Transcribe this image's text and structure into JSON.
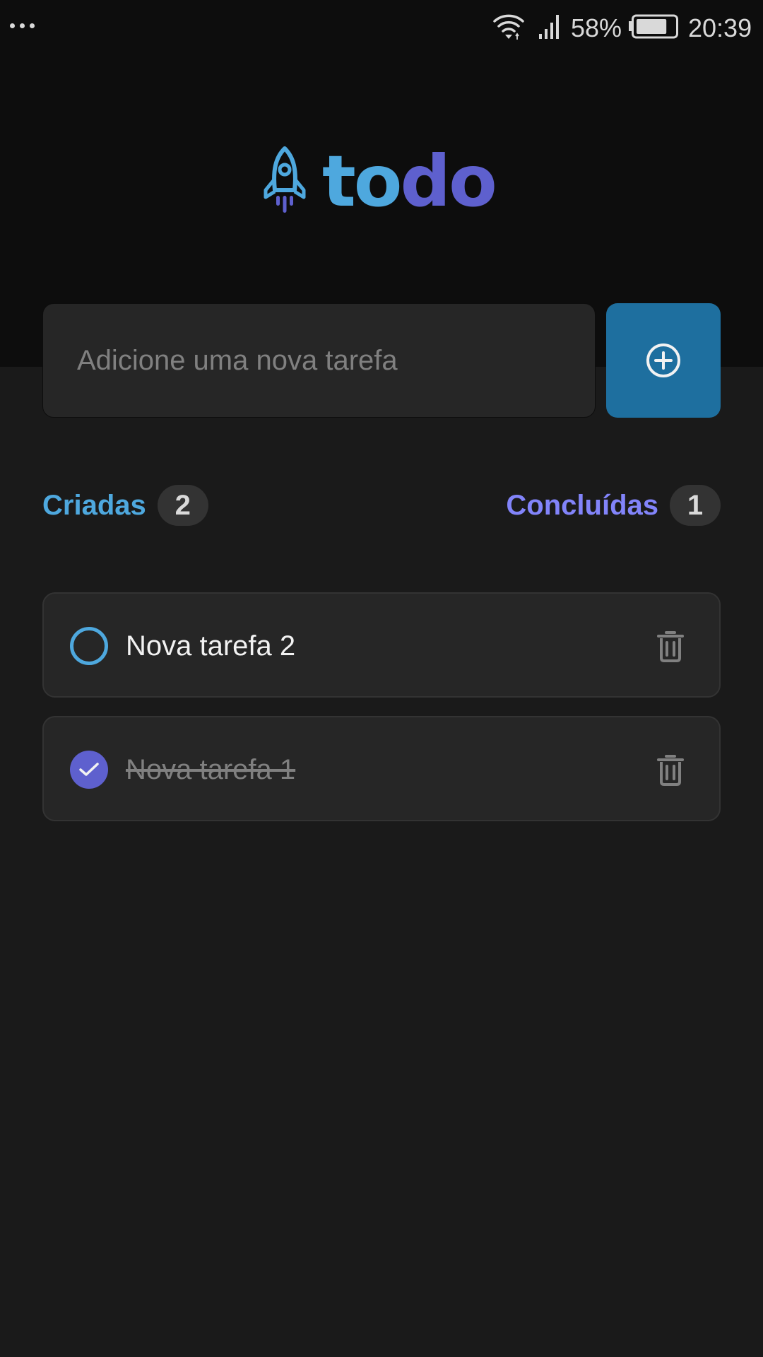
{
  "status_bar": {
    "menu_icon": "more-horizontal-icon",
    "wifi_icon": "wifi-icon",
    "signal_icon": "signal-icon",
    "battery_percent": "58%",
    "battery_icon": "battery-icon",
    "battery_level": 0.58,
    "time": "20:39"
  },
  "header": {
    "logo_icon": "rocket-icon",
    "logo_text_part1": "to",
    "logo_text_part2": "do",
    "colors": {
      "primary": "#4ea8de",
      "secondary": "#5e60ce"
    }
  },
  "new_task": {
    "placeholder": "Adicione uma nova tarefa",
    "value": "",
    "add_icon": "plus-circle-icon",
    "button_color": "#1e6f9f"
  },
  "counters": {
    "created_label": "Criadas",
    "created_count": "2",
    "done_label": "Concluídas",
    "done_count": "1"
  },
  "tasks": [
    {
      "text": "Nova tarefa 2",
      "completed": false,
      "delete_icon": "trash-icon"
    },
    {
      "text": "Nova tarefa 1",
      "completed": true,
      "delete_icon": "trash-icon"
    }
  ]
}
